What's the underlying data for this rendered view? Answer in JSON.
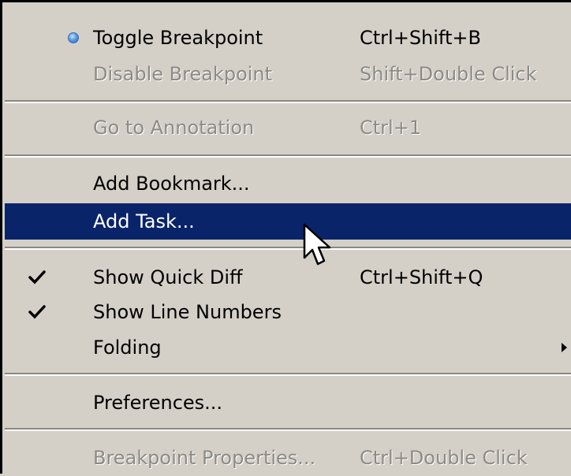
{
  "menu": {
    "items": [
      {
        "label": "Toggle Breakpoint",
        "shortcut": "Ctrl+Shift+B"
      },
      {
        "label": "Disable Breakpoint",
        "shortcut": "Shift+Double Click"
      },
      {
        "label": "Go to Annotation",
        "shortcut": "Ctrl+1"
      },
      {
        "label": "Add Bookmark..."
      },
      {
        "label": "Add Task..."
      },
      {
        "label": "Show Quick Diff",
        "shortcut": "Ctrl+Shift+Q"
      },
      {
        "label": "Show Line Numbers"
      },
      {
        "label": "Folding"
      },
      {
        "label": "Preferences..."
      },
      {
        "label": "Breakpoint Properties...",
        "shortcut": "Ctrl+Double Click"
      }
    ]
  },
  "colors": {
    "menu_background": "#d4d0c8",
    "highlight": "#0a246a",
    "disabled_text": "#8c8a84"
  },
  "icons": {
    "radio": "radio-dot-icon",
    "check": "checkmark-icon",
    "submenu": "submenu-arrow-icon",
    "cursor": "mouse-pointer-icon"
  }
}
